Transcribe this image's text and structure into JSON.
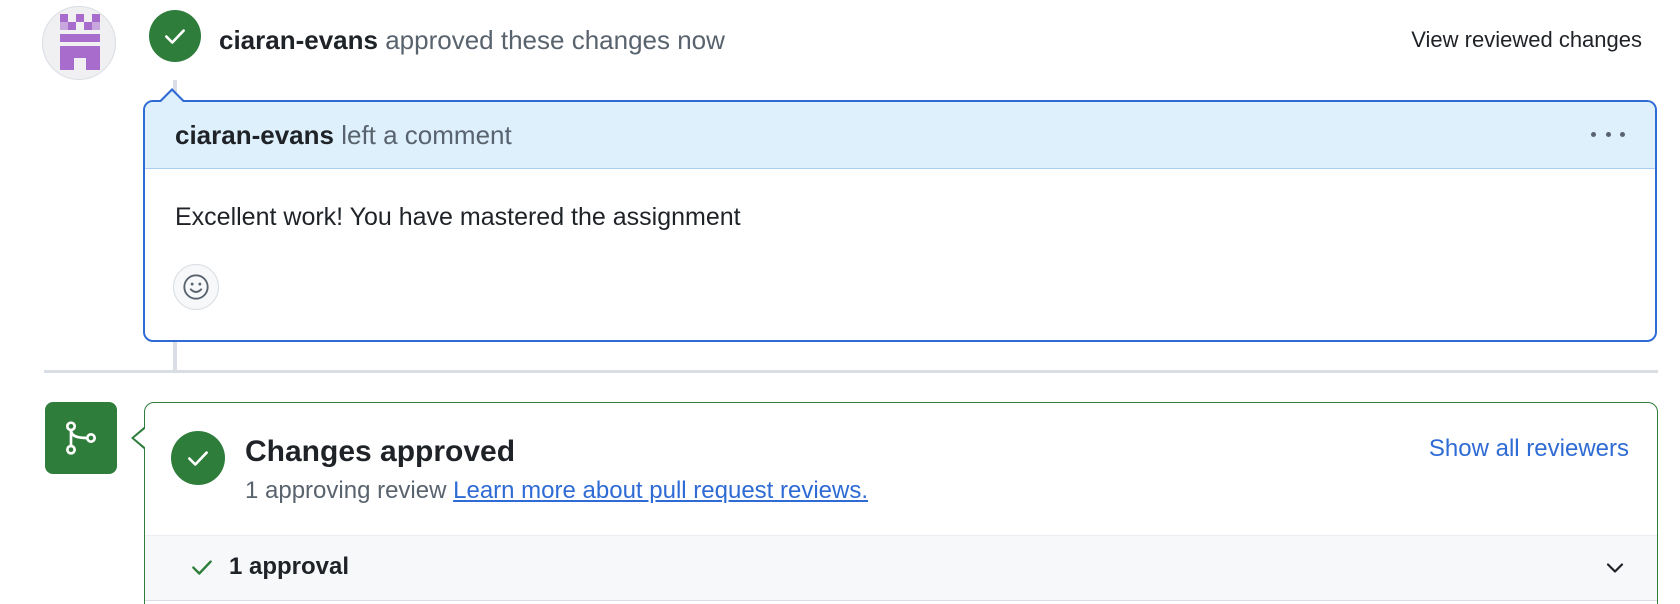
{
  "review_event": {
    "author": "ciaran-evans",
    "action": "approved these changes now",
    "view_reviewed_label": "View reviewed changes",
    "avatar_icon": "identicon-avatar",
    "badge_icon": "check-icon"
  },
  "comment": {
    "author": "ciaran-evans",
    "action": "left a comment",
    "body": "Excellent work! You have mastered the assignment",
    "menu_icon": "kebab-horizontal-icon",
    "reaction_icon": "smiley-icon"
  },
  "merge_box": {
    "icon": "git-merge-icon",
    "title": "Changes approved",
    "subtitle": "1 approving review",
    "learn_more_link": "Learn more about pull request reviews.",
    "show_reviewers_label": "Show all reviewers",
    "approvals_label": "1 approval",
    "approvals_expand_icon": "chevron-down-icon"
  },
  "colors": {
    "success": "#2f7d3b",
    "accent": "#2f6bd4",
    "comment_header_bg": "#ddf0fc",
    "muted_text": "#59636e",
    "avatar_purple": "#a86ccd"
  }
}
